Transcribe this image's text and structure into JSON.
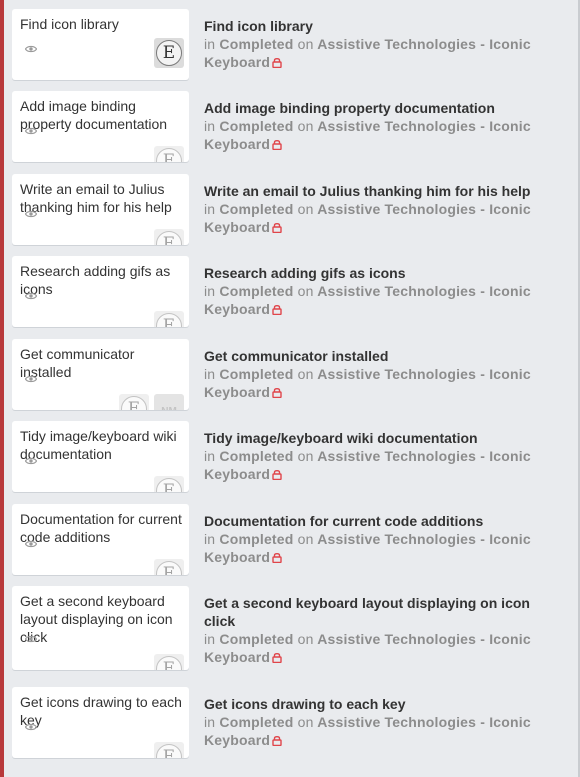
{
  "items": [
    {
      "card_title": "Find icon library",
      "title": "Find icon library",
      "in_word": "in",
      "list": "Completed",
      "on_word": "on",
      "board": "Assistive Technologies - Iconic Keyboard",
      "avatars": [
        "E"
      ]
    },
    {
      "card_title": "Add image binding property documentation",
      "title": "Add image binding property documentation",
      "in_word": "in",
      "list": "Completed",
      "on_word": "on",
      "board": "Assistive Technologies - Iconic Keyboard",
      "avatars": [
        "E"
      ]
    },
    {
      "card_title": "Write an email to Julius thanking him for his help",
      "title": "Write an email to Julius thanking him for his help",
      "in_word": "in",
      "list": "Completed",
      "on_word": "on",
      "board": "Assistive Technologies - Iconic Keyboard",
      "avatars": [
        "E"
      ]
    },
    {
      "card_title": "Research adding gifs as icons",
      "title": "Research adding gifs as icons",
      "in_word": "in",
      "list": "Completed",
      "on_word": "on",
      "board": "Assistive Technologies - Iconic Keyboard",
      "avatars": [
        "E"
      ]
    },
    {
      "card_title": "Get communicator installed",
      "title": "Get communicator installed",
      "in_word": "in",
      "list": "Completed",
      "on_word": "on",
      "board": "Assistive Technologies - Iconic Keyboard",
      "avatars": [
        "E",
        "NM"
      ]
    },
    {
      "card_title": "Tidy image/keyboard wiki documentation",
      "title": "Tidy image/keyboard wiki documentation",
      "in_word": "in",
      "list": "Completed",
      "on_word": "on",
      "board": "Assistive Technologies - Iconic Keyboard",
      "avatars": [
        "E"
      ]
    },
    {
      "card_title": "Documentation for current code additions",
      "title": "Documentation for current code additions",
      "in_word": "in",
      "list": "Completed",
      "on_word": "on",
      "board": "Assistive Technologies - Iconic Keyboard",
      "avatars": [
        "E"
      ]
    },
    {
      "card_title": "Get a second keyboard layout displaying on icon click",
      "title": "Get a second keyboard layout displaying on icon click",
      "in_word": "in",
      "list": "Completed",
      "on_word": "on",
      "board": "Assistive Technologies - Iconic Keyboard",
      "avatars": [
        "E"
      ]
    },
    {
      "card_title": "Get icons drawing to each key",
      "title": "Get icons drawing to each key",
      "in_word": "in",
      "list": "Completed",
      "on_word": "on",
      "board": "Assistive Technologies - Iconic Keyboard",
      "avatars": [
        "E"
      ]
    }
  ],
  "icons": {
    "watch": "eye-icon",
    "board_lock": "lock-icon"
  },
  "colors": {
    "background": "#e9ebee",
    "card": "#ffffff",
    "title_text": "#333333",
    "meta_text": "#8c8c8c",
    "lock": "#e0454a",
    "left_strip": "#b8393b"
  }
}
